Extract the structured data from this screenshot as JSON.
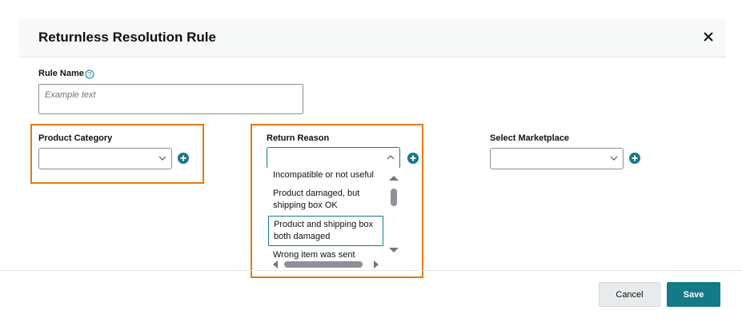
{
  "dialog": {
    "title": "Returnless Resolution Rule",
    "close_icon": "close-icon"
  },
  "rule_name": {
    "label": "Rule Name",
    "help_icon": "help-circle-icon",
    "placeholder": "Example text"
  },
  "product_category": {
    "label": "Product Category",
    "value": "",
    "add_icon": "plus-circle-icon"
  },
  "return_reason": {
    "label": "Return Reason",
    "value": "",
    "add_icon": "plus-circle-icon",
    "options": [
      {
        "label": "Incompatible or not useful"
      },
      {
        "label": "Product damaged, but shipping box OK"
      },
      {
        "label": "Product and shipping box both damaged",
        "selected": true
      },
      {
        "label": "Wrong item was sent"
      }
    ]
  },
  "marketplace": {
    "label": "Select Marketplace",
    "value": "",
    "add_icon": "plus-circle-icon"
  },
  "footer": {
    "cancel_label": "Cancel",
    "save_label": "Save"
  },
  "colors": {
    "accent": "#147a88",
    "highlight": "#e47911"
  }
}
